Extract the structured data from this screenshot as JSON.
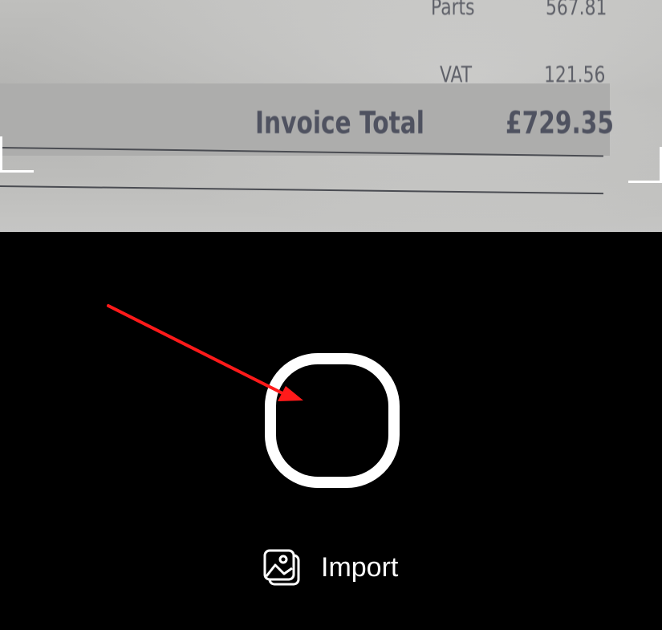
{
  "receipt": {
    "parts_label": "Parts",
    "parts_value": "567.81",
    "vat_label": "VAT",
    "vat_value": "121.56",
    "total_label": "Invoice Total",
    "total_value": "£729.35"
  },
  "controls": {
    "import_label": "Import",
    "shutter_icon": "circle-icon",
    "import_icon": "photo-library-icon"
  },
  "annotation": {
    "arrow_color": "#ff1a1a"
  }
}
